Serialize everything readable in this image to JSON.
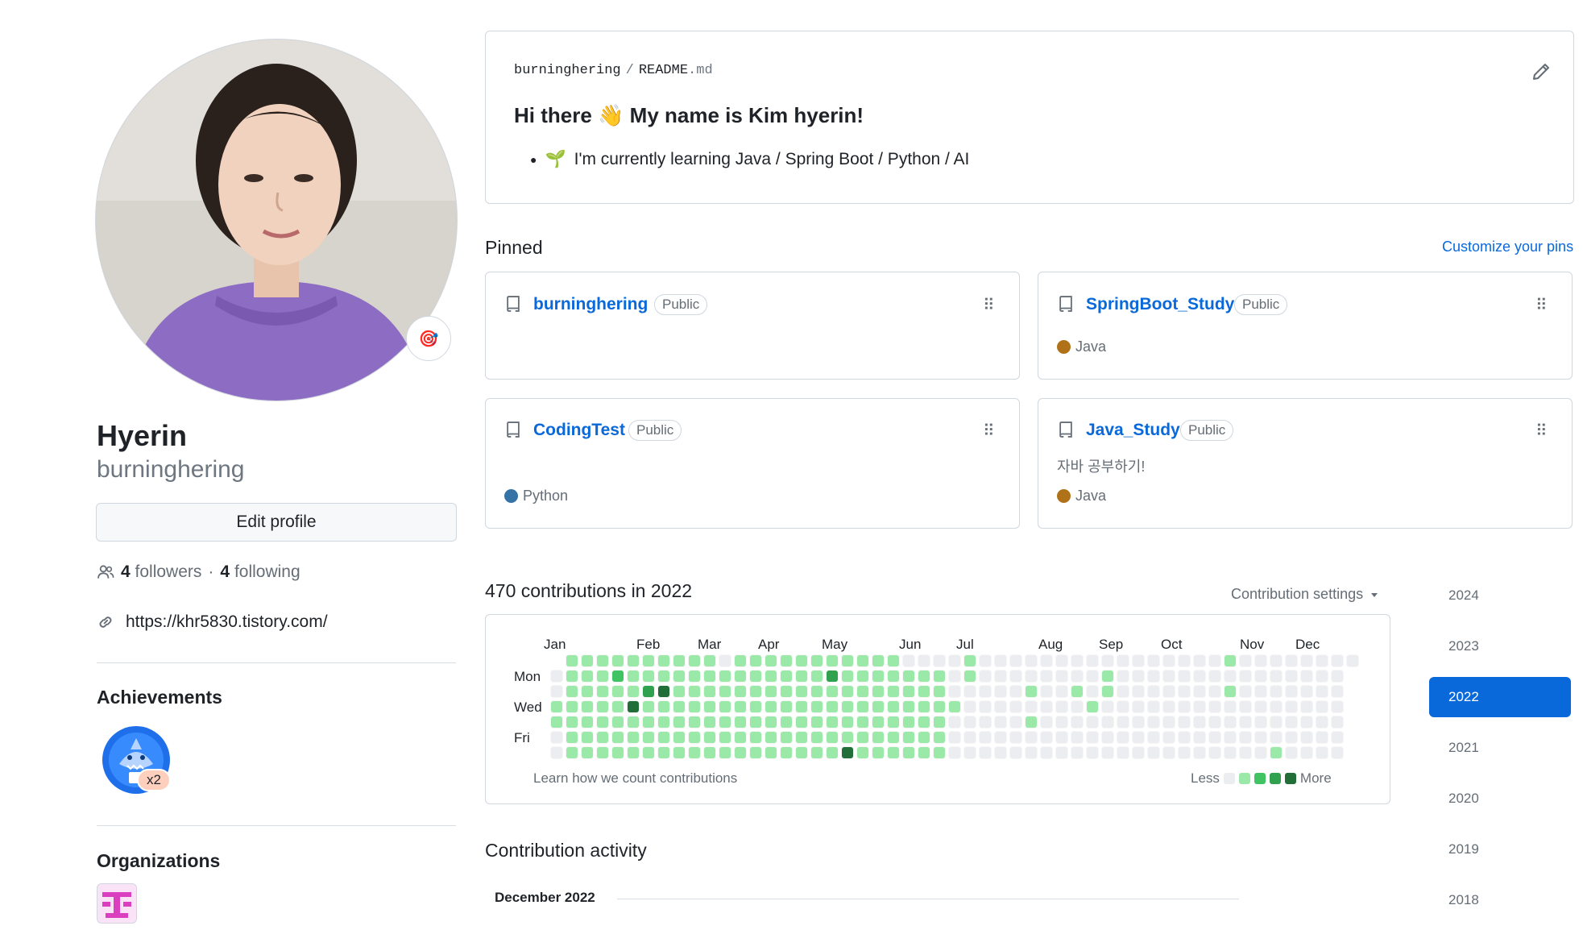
{
  "profile": {
    "name": "Hyerin",
    "login": "burninghering",
    "edit_profile": "Edit profile",
    "followers_count": "4",
    "followers_label": "followers",
    "separator": "·",
    "following_count": "4",
    "following_label": "following",
    "website": "https://khr5830.tistory.com/",
    "status_emoji": "🎯"
  },
  "achievements": {
    "heading": "Achievements",
    "badge_count": "x2"
  },
  "organizations": {
    "heading": "Organizations"
  },
  "readme": {
    "owner": "burninghering",
    "slash": "/",
    "file": "README",
    "ext": ".md",
    "title_pre": "Hi there",
    "wave": "👋",
    "title_post": "My name is Kim hyerin!",
    "bullet_emoji": "🌱",
    "bullet_text": "I'm currently learning Java / Spring Boot / Python / AI"
  },
  "pinned": {
    "heading": "Pinned",
    "customize": "Customize your pins",
    "cards": [
      {
        "name": "burninghering",
        "visibility": "Public",
        "description": "",
        "language": "",
        "language_color": ""
      },
      {
        "name": "SpringBoot_Study",
        "visibility": "Public",
        "description": "",
        "language": "Java",
        "language_color": "#b07219"
      },
      {
        "name": "CodingTest",
        "visibility": "Public",
        "description": "",
        "language": "Python",
        "language_color": "#3572A5"
      },
      {
        "name": "Java_Study",
        "visibility": "Public",
        "description": "자바 공부하기!",
        "language": "Java",
        "language_color": "#b07219"
      }
    ]
  },
  "contributions": {
    "heading": "470 contributions in 2022",
    "settings": "Contribution settings",
    "months": [
      "Jan",
      "Feb",
      "Mar",
      "Apr",
      "May",
      "Jun",
      "Jul",
      "Aug",
      "Sep",
      "Oct",
      "Nov",
      "Dec"
    ],
    "days": [
      "Mon",
      "Wed",
      "Fri"
    ],
    "learn": "Learn how we count contributions",
    "less": "Less",
    "more": "More",
    "colors": [
      "#ebedf0",
      "#9be9a8",
      "#40c463",
      "#30a14e",
      "#216e39"
    ]
  },
  "years": [
    "2024",
    "2023",
    "2022",
    "2021",
    "2020",
    "2019",
    "2018"
  ],
  "selected_year": "2022",
  "activity": {
    "heading": "Contribution activity",
    "month": "December 2022"
  }
}
